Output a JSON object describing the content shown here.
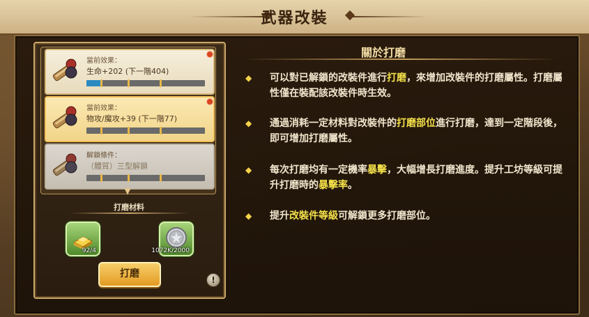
{
  "header": {
    "title": "武器改裝"
  },
  "about": {
    "title": "關於打磨",
    "bullets": [
      {
        "parts": [
          {
            "t": "可以對已解鎖的改裝件進行"
          },
          {
            "t": "打磨",
            "hl": true
          },
          {
            "t": "，來增加改裝件的打磨屬性。打磨屬性僅在裝配該改裝件時生效。"
          }
        ]
      },
      {
        "parts": [
          {
            "t": "通過消耗一定材料對改裝件的"
          },
          {
            "t": "打磨部位",
            "hl": true
          },
          {
            "t": "進行打磨，達到一定階段後，即可增加打磨屬性。"
          }
        ]
      },
      {
        "parts": [
          {
            "t": "每次打磨均有一定機率"
          },
          {
            "t": "暴擊",
            "hl": true
          },
          {
            "t": "，大幅增長打磨進度。提升工坊等級可提升打磨時的"
          },
          {
            "t": "暴擊率",
            "hl": true
          },
          {
            "t": "。"
          }
        ]
      },
      {
        "parts": [
          {
            "t": "提升"
          },
          {
            "t": "改裝件等級",
            "hl": true
          },
          {
            "t": "可解鎖更多打磨部位。"
          }
        ]
      }
    ],
    "bullet_symbol": "◆"
  },
  "cards": [
    {
      "label": "當前效果：",
      "value": "生命+202 (下一階404)",
      "progress": 0.12,
      "state": "normal"
    },
    {
      "label": "當前效果：",
      "value": "物攻/魔攻+39 (下一階77)",
      "progress": 0.0,
      "state": "active"
    },
    {
      "label": "解鎖條件：",
      "value": "（體質）三型解鎖",
      "progress": 0.0,
      "state": "locked"
    }
  ],
  "materials": {
    "title": "打磨材料",
    "items": [
      {
        "name": "gold-ingot",
        "qty": "92/4"
      },
      {
        "name": "silver-coin",
        "qty": "1072K/2000"
      }
    ]
  },
  "buttons": {
    "grind": "打磨",
    "info": "!"
  },
  "colors": {
    "highlight": "#f3e04a",
    "accent_gold": "#e39a22",
    "progress_blue": "#2c8ac0"
  }
}
